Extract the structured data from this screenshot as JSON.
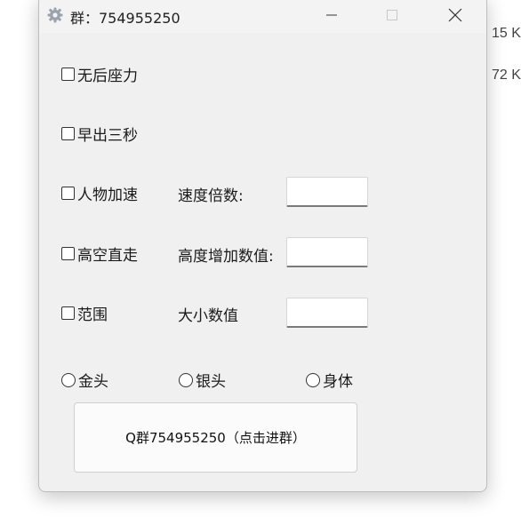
{
  "background": {
    "right_edge_texts": [
      "15 K",
      "72 K"
    ]
  },
  "window": {
    "title": "群：754955250",
    "icon": "gear-icon"
  },
  "checkboxes": [
    {
      "label": "无后座力",
      "checked": false
    },
    {
      "label": "早出三秒",
      "checked": false
    },
    {
      "label": "人物加速",
      "checked": false
    },
    {
      "label": "高空直走",
      "checked": false
    },
    {
      "label": "范围",
      "checked": false
    }
  ],
  "fields": [
    {
      "label": "速度倍数:",
      "value": ""
    },
    {
      "label": "高度增加数值:",
      "value": ""
    },
    {
      "label": "大小数值",
      "value": ""
    }
  ],
  "radios": [
    {
      "label": "金头",
      "selected": false
    },
    {
      "label": "银头",
      "selected": false
    },
    {
      "label": "身体",
      "selected": false
    }
  ],
  "join_button": {
    "label": "Q群754955250（点击进群）"
  }
}
